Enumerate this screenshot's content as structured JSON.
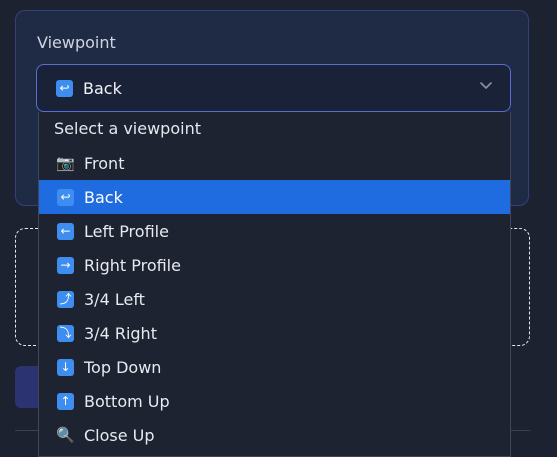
{
  "viewpoint": {
    "label": "Viewpoint",
    "selected": {
      "icon": "↩",
      "text": "Back"
    },
    "dropdown_title": "Select a viewpoint",
    "options": [
      {
        "icon": "📷",
        "text": "Front",
        "selected": false
      },
      {
        "icon": "↩",
        "text": "Back",
        "selected": true
      },
      {
        "icon": "←",
        "text": "Left Profile",
        "selected": false
      },
      {
        "icon": "→",
        "text": "Right Profile",
        "selected": false
      },
      {
        "icon": "⤴",
        "text": "3/4 Left",
        "selected": false
      },
      {
        "icon": "⤵",
        "text": "3/4 Right",
        "selected": false
      },
      {
        "icon": "↓",
        "text": "Top Down",
        "selected": false
      },
      {
        "icon": "↑",
        "text": "Bottom Up",
        "selected": false
      },
      {
        "icon": "🔍",
        "text": "Close Up",
        "selected": false
      }
    ]
  },
  "colors": {
    "accent": "#1f6ce0",
    "border_focus": "#5a6bd8",
    "background": "#1c2230",
    "panel": "#1f2a44"
  }
}
